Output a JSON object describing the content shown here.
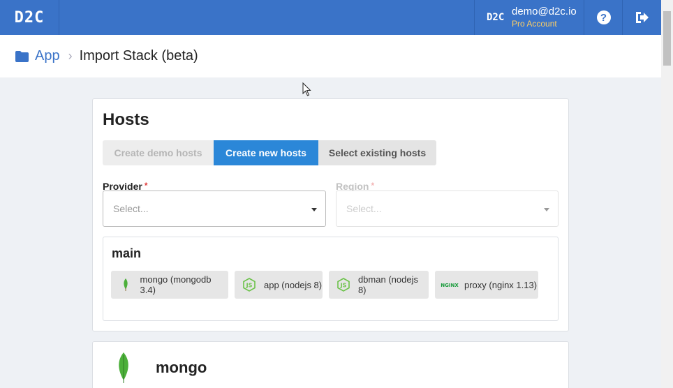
{
  "header": {
    "brand": "D2C",
    "user_avatar_text": "D2C",
    "user_email": "demo@d2c.io",
    "user_plan": "Pro Account",
    "help_icon": "question-circle-icon",
    "logout_icon": "logout-icon"
  },
  "breadcrumb": {
    "folder_icon": "folder-icon",
    "app_label": "App",
    "separator": "›",
    "page_title": "Import Stack (beta)"
  },
  "hosts": {
    "title": "Hosts",
    "tabs": [
      {
        "label": "Create demo hosts",
        "state": "disabled"
      },
      {
        "label": "Create new hosts",
        "state": "active"
      },
      {
        "label": "Select existing hosts",
        "state": "inactive"
      }
    ],
    "provider": {
      "label": "Provider",
      "required_mark": "*",
      "placeholder": "Select..."
    },
    "region": {
      "label": "Region",
      "required_mark": "*",
      "placeholder": "Select...",
      "state": "disabled"
    },
    "group": {
      "name": "main",
      "services": [
        {
          "label": "mongo (mongodb 3.4)",
          "icon": "mongodb-leaf-icon"
        },
        {
          "label": "app (nodejs 8)",
          "icon": "nodejs-icon"
        },
        {
          "label": "dbman (nodejs 8)",
          "icon": "nodejs-icon"
        },
        {
          "label": "proxy (nginx 1.13)",
          "icon": "nginx-icon"
        }
      ]
    }
  },
  "service_card": {
    "title": "mongo",
    "icon": "mongodb-leaf-icon"
  },
  "colors": {
    "topbar": "#3a73c8",
    "accent": "#2b87d8",
    "plan": "#ffcf63",
    "required": "#e03a3a",
    "mongo_green": "#4caf3a",
    "nodejs_green": "#6cc24a",
    "nginx_green": "#1a9b3c"
  }
}
